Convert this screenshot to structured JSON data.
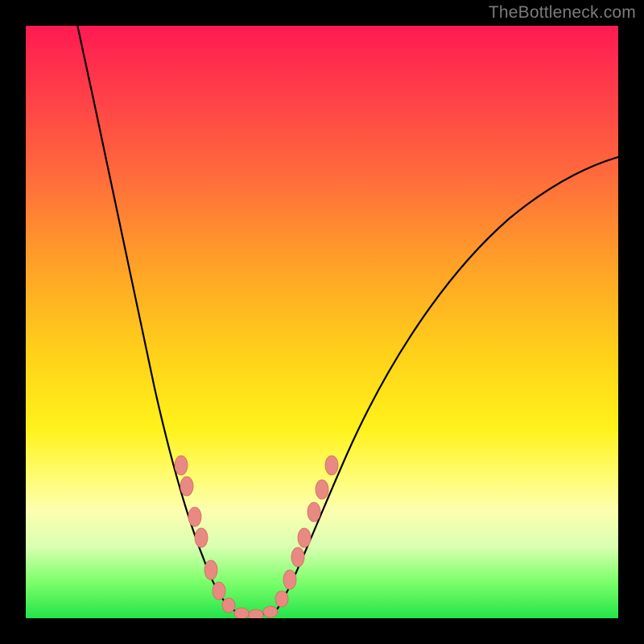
{
  "watermark": "TheBottleneck.com",
  "chart_data": {
    "type": "line",
    "title": "",
    "xlabel": "",
    "ylabel": "",
    "xlim": [
      0,
      100
    ],
    "ylim": [
      0,
      100
    ],
    "background_gradient": {
      "direction": "top-to-bottom",
      "stops": [
        {
          "pos": 0,
          "color": "#ff1a52"
        },
        {
          "pos": 25,
          "color": "#ff6a3c"
        },
        {
          "pos": 55,
          "color": "#ffd01a"
        },
        {
          "pos": 82,
          "color": "#fcffb0"
        },
        {
          "pos": 100,
          "color": "#24e34a"
        }
      ]
    },
    "series": [
      {
        "name": "bottleneck-curve",
        "x": [
          8,
          12,
          16,
          20,
          24,
          28,
          30,
          32,
          34,
          36,
          38,
          40,
          42,
          44,
          48,
          54,
          62,
          72,
          82,
          92,
          100
        ],
        "y": [
          102,
          88,
          72,
          56,
          40,
          24,
          14,
          6,
          2,
          0,
          0,
          2,
          6,
          12,
          24,
          40,
          56,
          68,
          74,
          77,
          78
        ]
      }
    ],
    "markers": {
      "name": "highlighted-points",
      "color": "#e98a82",
      "x": [
        26,
        27,
        28.5,
        29.5,
        31,
        32.5,
        34,
        36,
        38.5,
        41,
        43,
        44.5,
        46,
        47,
        48.5,
        50,
        51.5
      ],
      "y": [
        26,
        22,
        17,
        14,
        8,
        5,
        2,
        1,
        0.5,
        1,
        3,
        6.5,
        10,
        14,
        18,
        22,
        26
      ]
    }
  }
}
